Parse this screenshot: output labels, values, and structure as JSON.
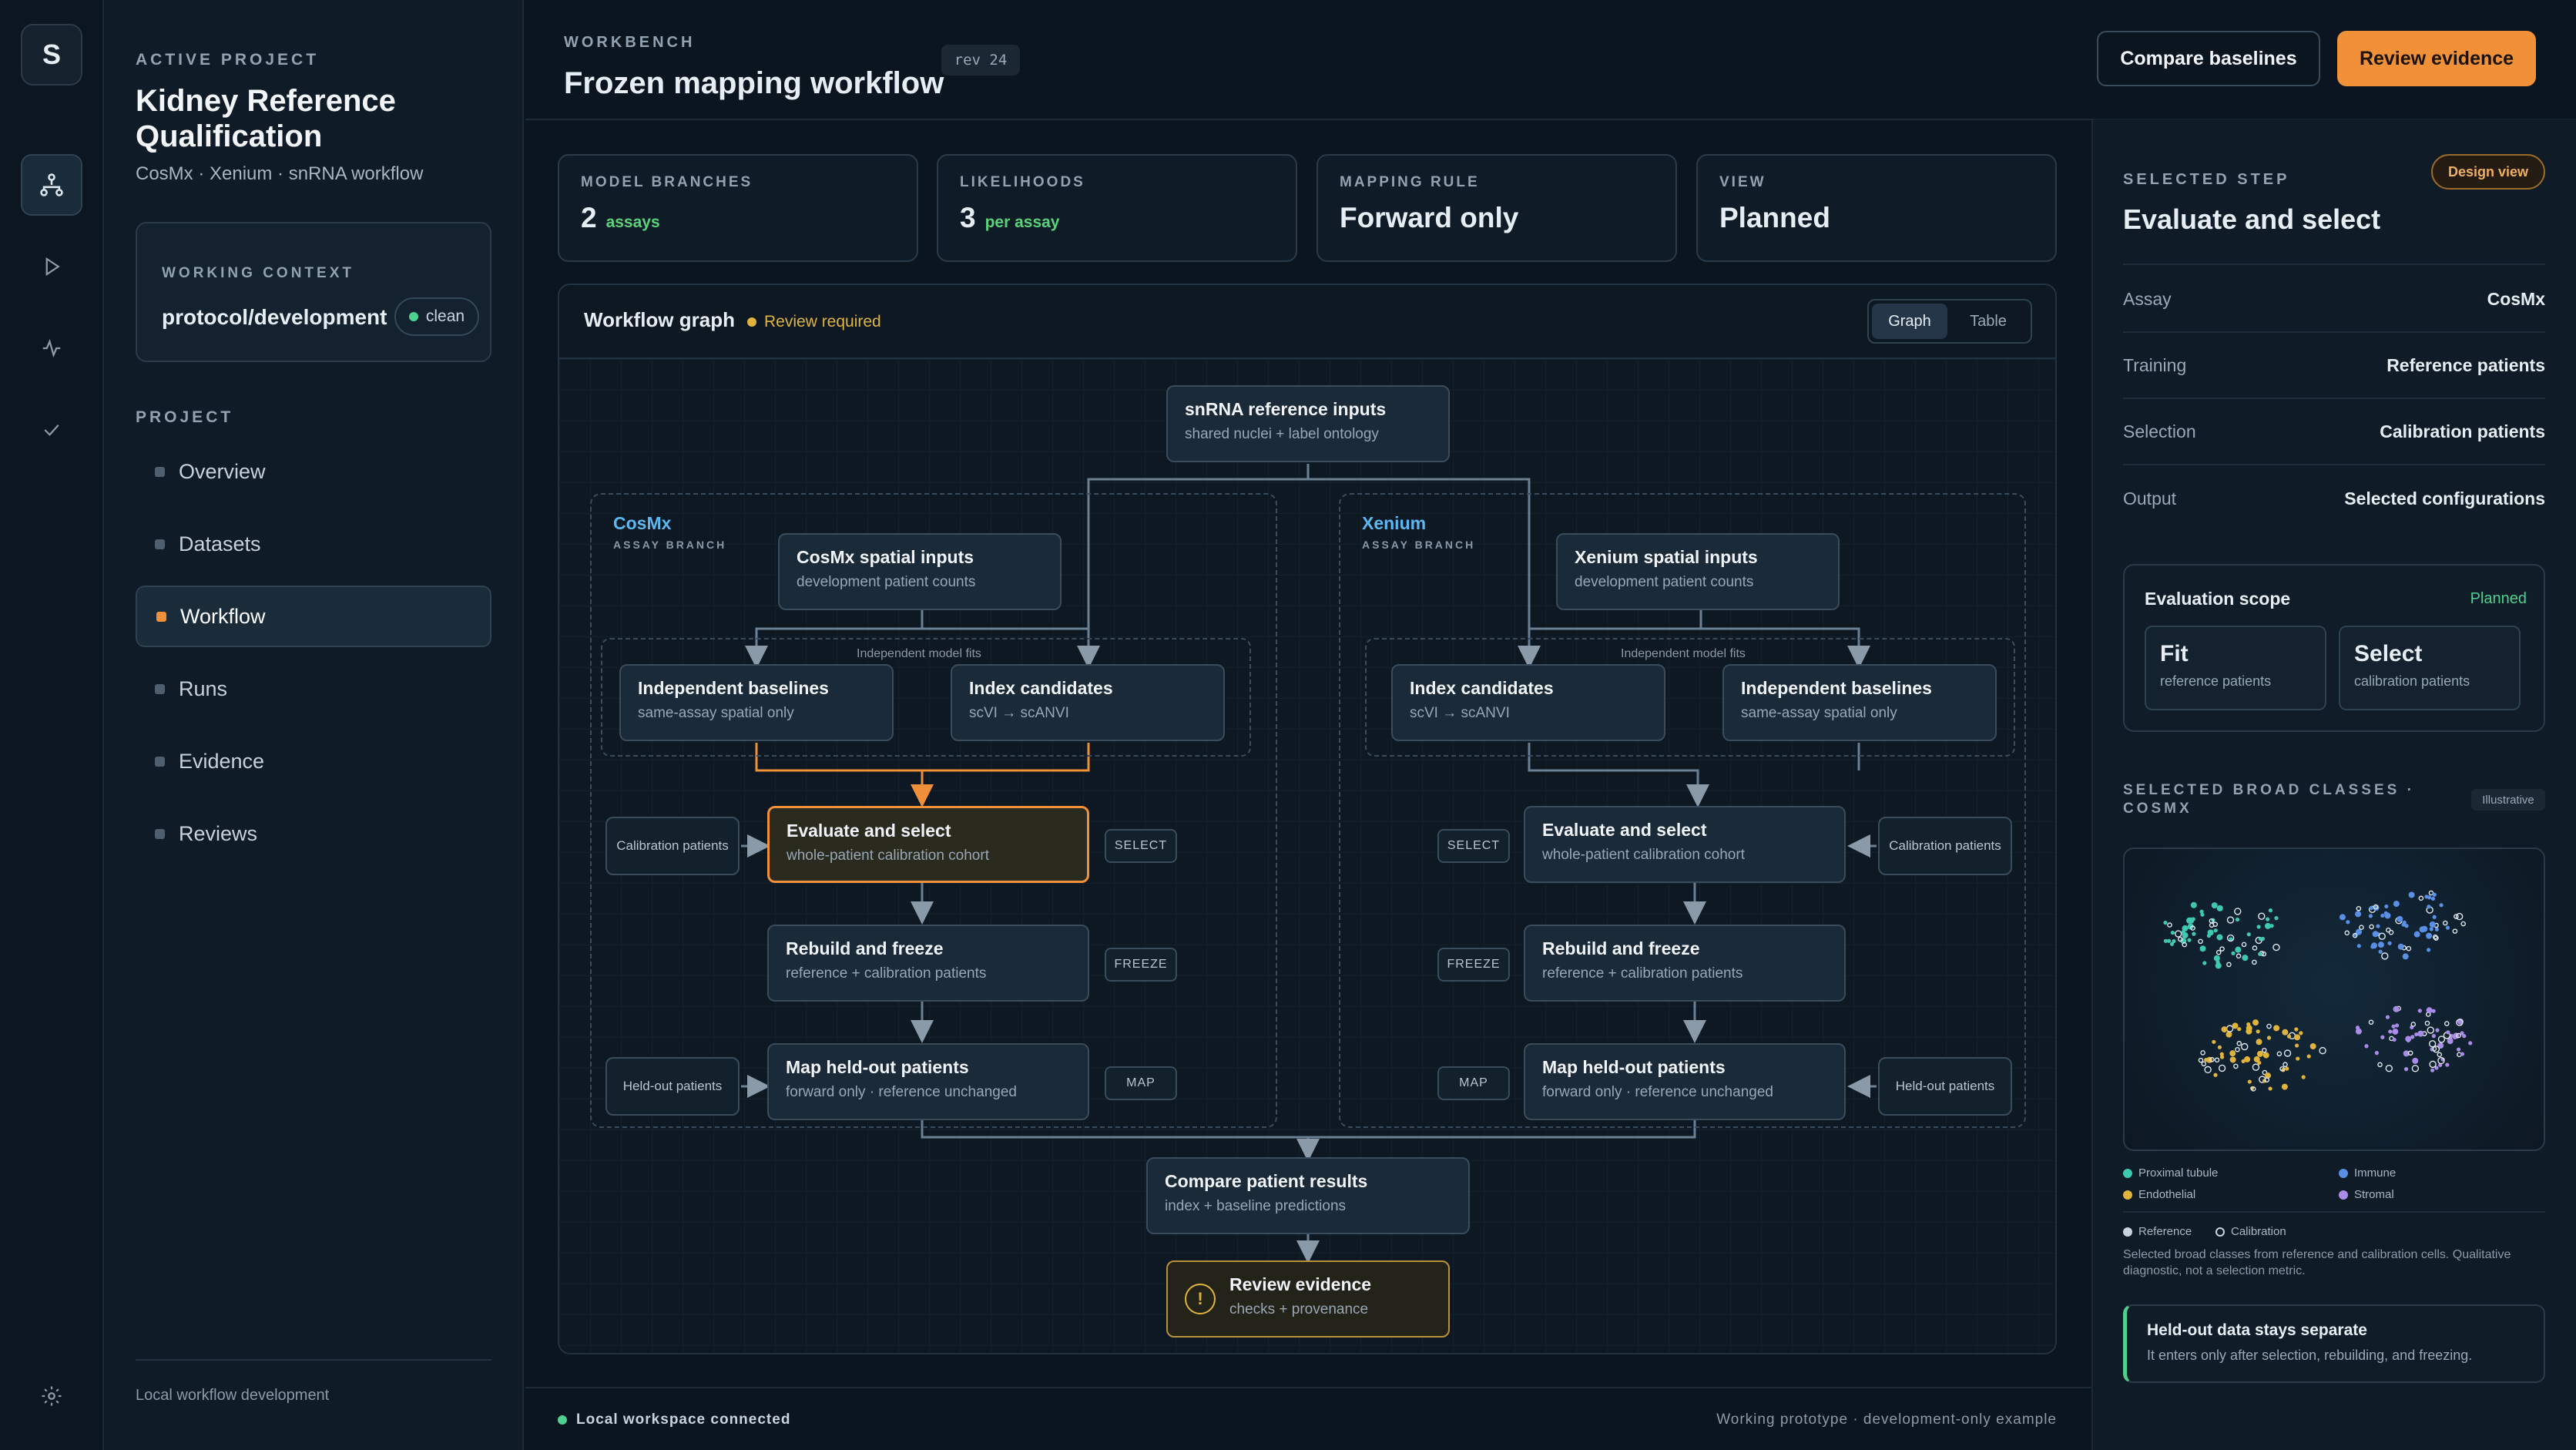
{
  "app": {
    "logo_letter": "S"
  },
  "sidebar": {
    "active_project_label": "ACTIVE PROJECT",
    "project_title": "Kidney Reference Qualification",
    "project_sub": "CosMx · Xenium · snRNA workflow",
    "context_label": "WORKING CONTEXT",
    "context_value": "protocol/development",
    "context_badge": "clean",
    "project_label": "PROJECT",
    "items": [
      {
        "label": "Overview"
      },
      {
        "label": "Datasets"
      },
      {
        "label": "Workflow"
      },
      {
        "label": "Runs"
      },
      {
        "label": "Evidence"
      },
      {
        "label": "Reviews"
      }
    ],
    "footer": "Local workflow development"
  },
  "header": {
    "eyebrow": "WORKBENCH",
    "title": "Frozen mapping workflow",
    "rev": "rev 24",
    "compare_btn": "Compare baselines",
    "review_btn": "Review evidence"
  },
  "stats": [
    {
      "k": "MODEL BRANCHES",
      "v": "2",
      "s": "assays"
    },
    {
      "k": "LIKELIHOODS",
      "v": "3",
      "s": "per assay"
    },
    {
      "k": "MAPPING RULE",
      "v": "Forward only",
      "s": ""
    },
    {
      "k": "VIEW",
      "v": "Planned",
      "s": ""
    }
  ],
  "graph": {
    "title": "Workflow graph",
    "status": "Review required",
    "tab_graph": "Graph",
    "tab_table": "Table",
    "top": {
      "t": "snRNA reference inputs",
      "d": "shared nuclei + label ontology"
    },
    "cos": {
      "name": "CosMx",
      "sub": "ASSAY BRANCH",
      "inputs": {
        "t": "CosMx spatial inputs",
        "d": "development patient counts"
      },
      "fits": "Independent model fits",
      "base": {
        "t": "Independent baselines",
        "d": "same-assay spatial only"
      },
      "idx": {
        "t": "Index candidates",
        "d": "scVI → scANVI"
      },
      "eval": {
        "t": "Evaluate and select",
        "d": "whole-patient calibration cohort"
      },
      "rebuild": {
        "t": "Rebuild and freeze",
        "d": "reference + calibration patients"
      },
      "map": {
        "t": "Map held-out patients",
        "d": "forward only · reference unchanged"
      },
      "calib": "Calibration patients",
      "held": "Held-out patients",
      "tag_select": "SELECT",
      "tag_freeze": "FREEZE",
      "tag_map": "MAP"
    },
    "xen": {
      "name": "Xenium",
      "sub": "ASSAY BRANCH",
      "inputs": {
        "t": "Xenium spatial inputs",
        "d": "development patient counts"
      },
      "fits": "Independent model fits",
      "idx": {
        "t": "Index candidates",
        "d": "scVI → scANVI"
      },
      "base": {
        "t": "Independent baselines",
        "d": "same-assay spatial only"
      },
      "eval": {
        "t": "Evaluate and select",
        "d": "whole-patient calibration cohort"
      },
      "rebuild": {
        "t": "Rebuild and freeze",
        "d": "reference + calibration patients"
      },
      "map": {
        "t": "Map held-out patients",
        "d": "forward only · reference unchanged"
      },
      "calib": "Calibration patients",
      "held": "Held-out patients",
      "tag_select": "SELECT",
      "tag_freeze": "FREEZE",
      "tag_map": "MAP"
    },
    "compare": {
      "t": "Compare patient results",
      "d": "index + baseline predictions"
    },
    "review": {
      "t": "Review evidence",
      "d": "checks + provenance",
      "icon": "!"
    }
  },
  "detail": {
    "eyebrow": "SELECTED STEP",
    "badge": "Design view",
    "title": "Evaluate and select",
    "rows": [
      {
        "k": "Assay",
        "v": "CosMx"
      },
      {
        "k": "Training",
        "v": "Reference patients"
      },
      {
        "k": "Selection",
        "v": "Calibration patients"
      },
      {
        "k": "Output",
        "v": "Selected configurations"
      }
    ],
    "scope_title": "Evaluation scope",
    "scope_status": "Planned",
    "fit_t": "Fit",
    "fit_d": "reference patients",
    "sel_t": "Select",
    "sel_d": "calibration patients",
    "classes_label": "SELECTED BROAD CLASSES · COSMX",
    "illustrative": "Illustrative",
    "legend": [
      "Proximal tubule",
      "Immune",
      "Endothelial",
      "Stromal"
    ],
    "legend2": [
      "Reference",
      "Calibration"
    ],
    "caption": "Selected broad classes from reference and calibration cells. Qualitative diagnostic, not a selection metric.",
    "note_title": "Held-out data stays separate",
    "note_text": "It enters only after selection, rebuilding, and freezing."
  },
  "footer": {
    "status": "Local workspace connected",
    "right": "Working prototype · development-only example"
  },
  "colors": {
    "accent": "#f0913a",
    "green": "#4ed08e",
    "blue": "#5bb8f0",
    "amber": "#e0b43c"
  }
}
